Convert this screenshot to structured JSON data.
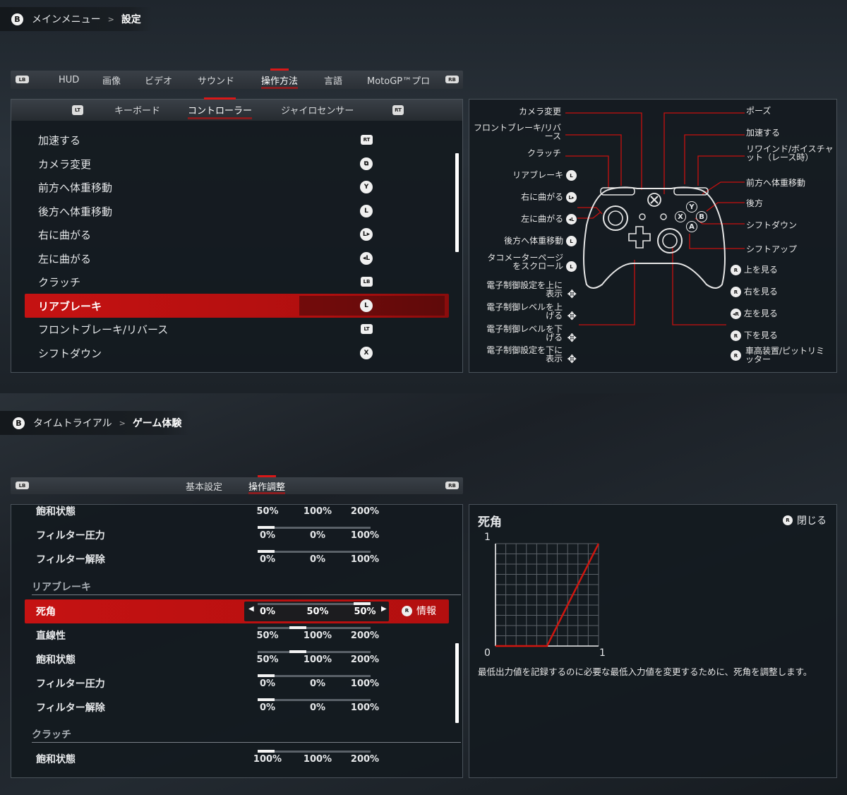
{
  "top": {
    "breadcrumb": {
      "button": "B",
      "parent": "メインメニュー",
      "current": "設定"
    },
    "tabs_lb": "LB",
    "tabs_rb": "RB",
    "tabs": [
      "HUD",
      "画像",
      "ビデオ",
      "サウンド",
      "操作方法",
      "言語",
      "MotoGP™プロ"
    ],
    "active_tab": "操作方法",
    "subtabs_lt": "LT",
    "subtabs_rt": "RT",
    "subtabs": [
      "キーボード",
      "コントローラー",
      "ジャイロセンサー"
    ],
    "active_subtab": "コントローラー",
    "bindings": [
      {
        "label": "加速する",
        "key": "RT"
      },
      {
        "label": "カメラ変更",
        "key": "⧉"
      },
      {
        "label": "前方へ体重移動",
        "key": "Y"
      },
      {
        "label": "後方へ体重移動",
        "key": "L"
      },
      {
        "label": "右に曲がる",
        "key": "L▸"
      },
      {
        "label": "左に曲がる",
        "key": "◂L"
      },
      {
        "label": "クラッチ",
        "key": "LB"
      },
      {
        "label": "リアブレーキ",
        "key": "L"
      },
      {
        "label": "フロントブレーキ/リバース",
        "key": "LT"
      },
      {
        "label": "シフトダウン",
        "key": "X"
      }
    ],
    "selected_binding": "リアブレーキ",
    "controller": {
      "left_labels": [
        {
          "text": "カメラ変更"
        },
        {
          "text": "フロントブレーキ/リバース"
        },
        {
          "text": "クラッチ"
        },
        {
          "text": "リアブレーキ",
          "icon": "L"
        },
        {
          "text": "右に曲がる",
          "icon": "L▸"
        },
        {
          "text": "左に曲がる",
          "icon": "◂L"
        },
        {
          "text": "後方へ体重移動",
          "icon": "L"
        },
        {
          "text": "タコメーターページをスクロール",
          "icon": "L"
        },
        {
          "text": "電子制御設定を上に表示",
          "icon": "dpad"
        },
        {
          "text": "電子制御レベルを上げる",
          "icon": "dpad"
        },
        {
          "text": "電子制御レベルを下げる",
          "icon": "dpad"
        },
        {
          "text": "電子制御設定を下に表示",
          "icon": "dpad"
        }
      ],
      "right_labels": [
        {
          "text": "ポーズ"
        },
        {
          "text": "加速する"
        },
        {
          "text": "リワインド/ボイスチャット（レース時）"
        },
        {
          "text": "前方へ体重移動"
        },
        {
          "text": "後方"
        },
        {
          "text": "シフトダウン"
        },
        {
          "text": "シフトアップ"
        },
        {
          "text": "上を見る",
          "icon": "R"
        },
        {
          "text": "右を見る",
          "icon": "R"
        },
        {
          "text": "左を見る",
          "icon": "◂R"
        },
        {
          "text": "下を見る",
          "icon": "R"
        },
        {
          "text": "車高装置/ピットリミッター",
          "icon": "R"
        }
      ],
      "face_buttons": [
        "Y",
        "X",
        "B",
        "A"
      ]
    }
  },
  "bottom": {
    "breadcrumb": {
      "button": "B",
      "parent": "タイムトライアル",
      "current": "ゲーム体験"
    },
    "tabs_lb": "LB",
    "tabs_rb": "RB",
    "tabs": [
      "基本設定",
      "操作調整"
    ],
    "active_tab": "操作調整",
    "rows_a": [
      {
        "label": "飽和状態",
        "min": "50%",
        "val": "100%",
        "max": "200%",
        "pos": 0.33
      },
      {
        "label": "フィルター圧力",
        "min": "0%",
        "val": "0%",
        "max": "100%",
        "pos": 0
      },
      {
        "label": "フィルター解除",
        "min": "0%",
        "val": "0%",
        "max": "100%",
        "pos": 0
      }
    ],
    "section_rear": "リアブレーキ",
    "rows_b": [
      {
        "label": "死角",
        "min": "0%",
        "val": "50%",
        "max": "50%",
        "pos": 1,
        "selected": true,
        "info": "情報"
      },
      {
        "label": "直線性",
        "min": "50%",
        "val": "100%",
        "max": "200%",
        "pos": 0.33
      },
      {
        "label": "飽和状態",
        "min": "50%",
        "val": "100%",
        "max": "200%",
        "pos": 0.33
      },
      {
        "label": "フィルター圧力",
        "min": "0%",
        "val": "0%",
        "max": "100%",
        "pos": 0
      },
      {
        "label": "フィルター解除",
        "min": "0%",
        "val": "0%",
        "max": "100%",
        "pos": 0
      }
    ],
    "section_clutch": "クラッチ",
    "rows_c": [
      {
        "label": "飽和状態",
        "min": "100%",
        "val": "100%",
        "max": "200%",
        "pos": 0
      }
    ],
    "deadzone": {
      "title": "死角",
      "close_label": "閉じる",
      "axis_y_max": "1",
      "axis_origin": "0",
      "axis_x_max": "1",
      "deadzone_value": 0.5,
      "description": "最低出力値を記録するのに必要な最低入力値を変更するために、死角を調整します。"
    }
  },
  "colors": {
    "accent": "#c8110f",
    "panel": "#141a20"
  }
}
